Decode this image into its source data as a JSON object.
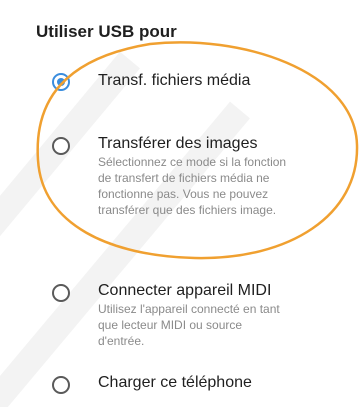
{
  "section": {
    "title": "Utiliser USB pour"
  },
  "options": [
    {
      "label": "Transf. fichiers média",
      "description": "",
      "selected": true
    },
    {
      "label": "Transférer des images",
      "description": "Sélectionnez ce mode si la fonction de transfert de fichiers média ne fonctionne pas. Vous ne pouvez transférer que des fichiers image.",
      "selected": false
    },
    {
      "label": "Connecter appareil MIDI",
      "description": "Utilisez l'appareil connecté en tant que lecteur MIDI ou source d'entrée.",
      "selected": false
    },
    {
      "label": "Charger ce téléphone",
      "description": "",
      "selected": false
    }
  ],
  "colors": {
    "accent": "#3a8dde",
    "highlight_ellipse": "#f0a030",
    "text_primary": "#1f1f1f",
    "text_secondary": "#8a8a8a"
  }
}
